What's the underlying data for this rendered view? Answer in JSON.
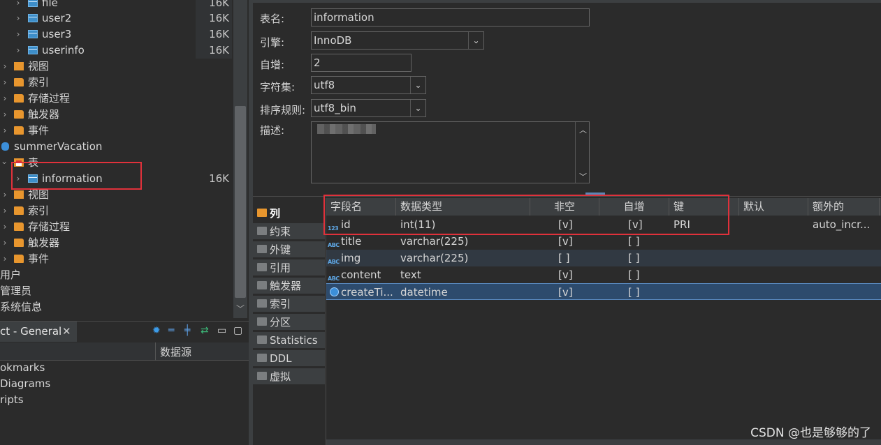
{
  "navigator": {
    "rows": [
      {
        "label": "file",
        "size": "16K",
        "icon": "table-icon"
      },
      {
        "label": "user2",
        "size": "16K",
        "icon": "table-icon"
      },
      {
        "label": "user3",
        "size": "16K",
        "icon": "table-icon"
      },
      {
        "label": "userinfo",
        "size": "16K",
        "icon": "table-icon"
      },
      {
        "label": "视图",
        "icon": "view-folder-icon"
      },
      {
        "label": "索引",
        "icon": "folder-icon"
      },
      {
        "label": "存储过程",
        "icon": "folder-icon"
      },
      {
        "label": "触发器",
        "icon": "folder-icon"
      },
      {
        "label": "事件",
        "icon": "folder-icon"
      },
      {
        "label": "summerVacation",
        "icon": "database-icon"
      },
      {
        "label": "表",
        "icon": "table-folder-icon"
      },
      {
        "label": "information",
        "size": "16K",
        "icon": "table-icon"
      },
      {
        "label": "视图",
        "icon": "view-folder-icon"
      },
      {
        "label": "索引",
        "icon": "folder-icon"
      },
      {
        "label": "存储过程",
        "icon": "folder-icon"
      },
      {
        "label": "触发器",
        "icon": "folder-icon"
      },
      {
        "label": "事件",
        "icon": "folder-icon"
      },
      {
        "label": "用户"
      },
      {
        "label": "管理员"
      },
      {
        "label": "系统信息"
      }
    ]
  },
  "project_panel": {
    "tab_label": "ct - General",
    "column_2": "数据源",
    "items": [
      "okmarks",
      "Diagrams",
      "ripts"
    ]
  },
  "properties": {
    "table_name_label": "表名:",
    "table_name_value": "information",
    "engine_label": "引擎:",
    "engine_value": "InnoDB",
    "auto_inc_label": "自增:",
    "auto_inc_value": "2",
    "charset_label": "字符集:",
    "charset_value": "utf8",
    "collation_label": "排序规则:",
    "collation_value": "utf8_bin",
    "description_label": "描述:"
  },
  "side_tabs": [
    "列",
    "约束",
    "外键",
    "引用",
    "触发器",
    "索引",
    "分区",
    "Statistics",
    "DDL",
    "虚拟"
  ],
  "grid": {
    "headers": [
      "字段名",
      "数据类型",
      "非空",
      "自增",
      "键",
      "默认",
      "额外的"
    ],
    "rows": [
      {
        "type_icon": "123",
        "name": "id",
        "type": "int(11)",
        "not_null": "[v]",
        "auto_inc": "[v]",
        "key": "PRI",
        "default": "",
        "extra": "auto_incr..."
      },
      {
        "type_icon": "ABC",
        "name": "title",
        "type": "varchar(225)",
        "not_null": "[v]",
        "auto_inc": "[ ]",
        "key": "",
        "default": "",
        "extra": ""
      },
      {
        "type_icon": "ABC",
        "name": "img",
        "type": "varchar(225)",
        "not_null": "[ ]",
        "auto_inc": "[ ]",
        "key": "",
        "default": "",
        "extra": ""
      },
      {
        "type_icon": "ABC",
        "name": "content",
        "type": "text",
        "not_null": "[v]",
        "auto_inc": "[ ]",
        "key": "",
        "default": "",
        "extra": ""
      },
      {
        "type_icon": "clock",
        "name": "createTi...",
        "type": "datetime",
        "not_null": "[v]",
        "auto_inc": "[ ]",
        "key": "",
        "default": "",
        "extra": ""
      }
    ]
  },
  "watermark": "CSDN @也是够够的了",
  "colors": {
    "highlight_box": "#e0313b",
    "selection": "#2d4b6d",
    "folder": "#e8962e",
    "table": "#3d8ec9"
  }
}
